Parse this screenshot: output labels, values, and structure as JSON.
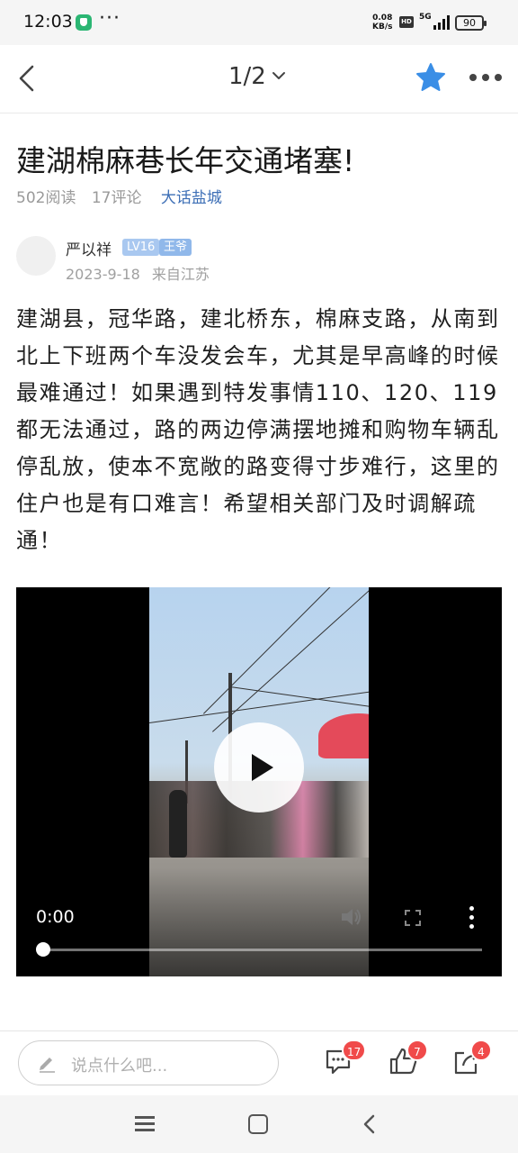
{
  "status_bar": {
    "time": "12:03",
    "more_dots": "···",
    "net_speed_value": "0.08",
    "net_speed_unit": "KB/s",
    "hd_label": "HD",
    "network_label": "5G",
    "battery": "90"
  },
  "nav": {
    "page_indicator": "1/2",
    "icons": [
      "back-arrow-icon",
      "chevron-down-icon",
      "star-icon",
      "more-icon"
    ],
    "star_color": "#3a8ee6"
  },
  "article": {
    "title": "建湖棉麻巷长年交通堵塞!",
    "reads": "502阅读",
    "comments": "17评论",
    "circle": "大话盐城",
    "author": {
      "name": "严以祥",
      "level": "LV16",
      "role": "王爷",
      "date": "2023-9-18",
      "location": "来自江苏"
    },
    "body": "建湖县，冠华路，建北桥东，棉麻支路，从南到北上下班两个车没发会车，尤其是早高峰的时候最难通过！如果遇到特发事情110、120、119都无法通过，路的两边停满摆地摊和购物车辆乱停乱放，使本不宽敞的路变得寸步难行，这里的住户也是有口难言！希望相关部门及时调解疏通！"
  },
  "video": {
    "current_time": "0:00",
    "progress": 0,
    "icons": [
      "play-icon",
      "volume-icon",
      "fullscreen-icon",
      "video-menu-icon"
    ]
  },
  "action_bar": {
    "comment_placeholder": "说点什么吧...",
    "comment_count": "17",
    "like_count": "7",
    "share_count": "4",
    "badge_color": "#f04a4a"
  },
  "system_nav": {
    "icons": [
      "menu-icon",
      "home-icon",
      "back-icon"
    ]
  }
}
